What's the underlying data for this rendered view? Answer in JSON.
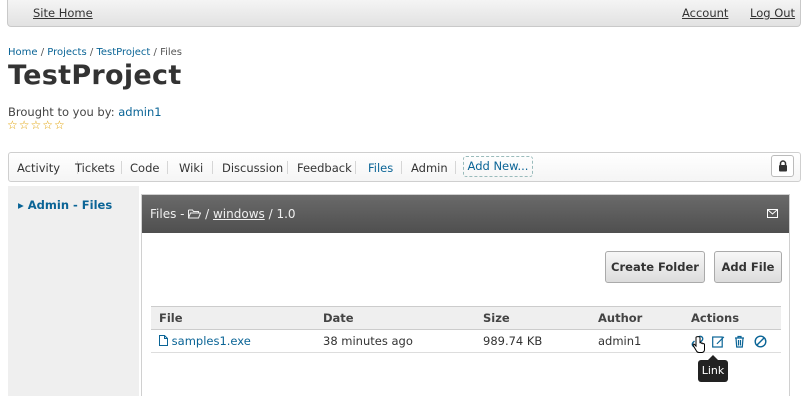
{
  "topbar": {
    "site_home": "Site Home",
    "account": "Account",
    "logout": "Log Out"
  },
  "breadcrumb": {
    "home": "Home",
    "projects": "Projects",
    "project": "TestProject",
    "current": "Files",
    "sep": " / "
  },
  "project": {
    "title": "TestProject",
    "byline_prefix": "Brought to you by:",
    "author": "admin1",
    "stars": "☆☆☆☆☆"
  },
  "tabs": [
    "Activity",
    "Tickets",
    "Code",
    "Wiki",
    "Discussion",
    "Feedback",
    "Files",
    "Admin"
  ],
  "tab_add": "Add New...",
  "active_tab": "Files",
  "sidebar": {
    "item": "Admin - Files"
  },
  "panel": {
    "title_prefix": "Files - ",
    "folder": "windows",
    "version": "/ 1.0"
  },
  "buttons": {
    "create_folder": "Create Folder",
    "add_file": "Add File"
  },
  "table": {
    "headers": [
      "File",
      "Date",
      "Size",
      "Author",
      "Actions"
    ],
    "rows": [
      {
        "file": "samples1.exe",
        "date": "38 minutes ago",
        "size": "989.74 KB",
        "author": "admin1"
      }
    ]
  },
  "tooltip": "Link",
  "colors": {
    "link": "#0a6496",
    "panel_header": "#5a5a5a",
    "star": "#e0a000"
  }
}
